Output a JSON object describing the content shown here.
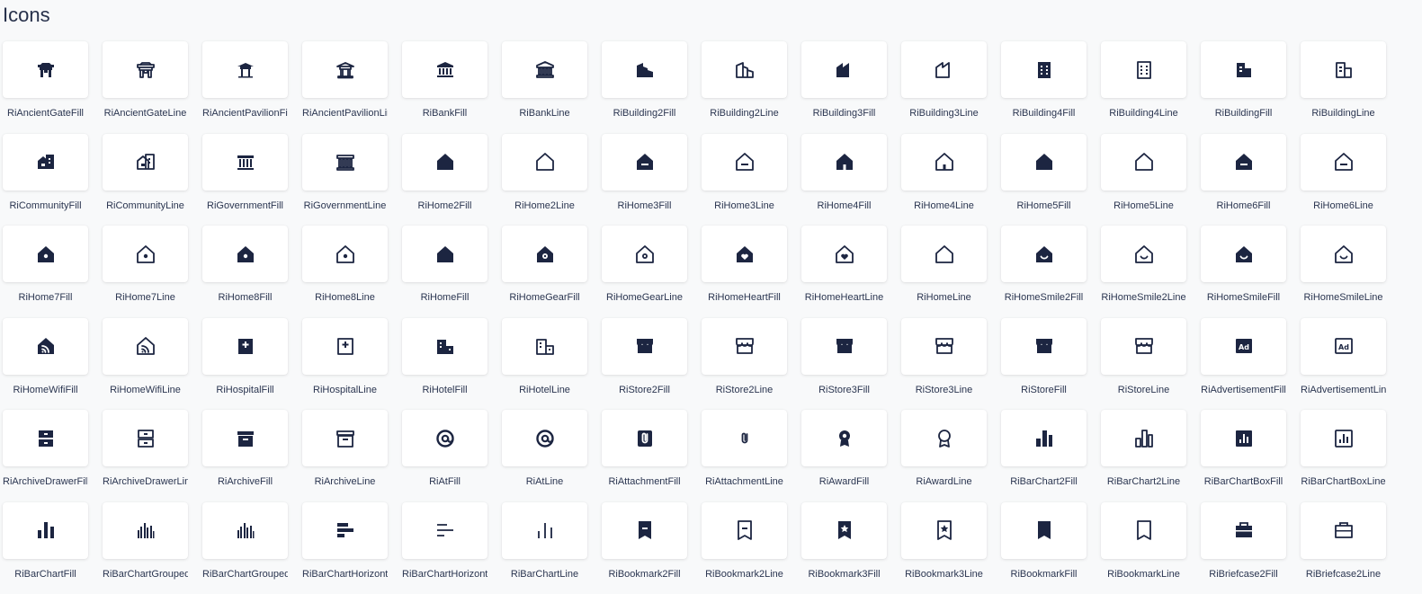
{
  "page": {
    "title": "Icons"
  },
  "icons": [
    {
      "label": "RiAncientGateFill",
      "icon": "ancient-gate-fill"
    },
    {
      "label": "RiAncientGateLine",
      "icon": "ancient-gate-line"
    },
    {
      "label": "RiAncientPavilionFil",
      "icon": "ancient-pavilion-fill"
    },
    {
      "label": "RiAncientPavilionLir",
      "icon": "ancient-pavilion-line"
    },
    {
      "label": "RiBankFill",
      "icon": "bank-fill"
    },
    {
      "label": "RiBankLine",
      "icon": "bank-line"
    },
    {
      "label": "RiBuilding2Fill",
      "icon": "building2-fill"
    },
    {
      "label": "RiBuilding2Line",
      "icon": "building2-line"
    },
    {
      "label": "RiBuilding3Fill",
      "icon": "building3-fill"
    },
    {
      "label": "RiBuilding3Line",
      "icon": "building3-line"
    },
    {
      "label": "RiBuilding4Fill",
      "icon": "building4-fill"
    },
    {
      "label": "RiBuilding4Line",
      "icon": "building4-line"
    },
    {
      "label": "RiBuildingFill",
      "icon": "building-fill"
    },
    {
      "label": "RiBuildingLine",
      "icon": "building-line"
    },
    {
      "label": "RiCommunityFill",
      "icon": "community-fill"
    },
    {
      "label": "RiCommunityLine",
      "icon": "community-line"
    },
    {
      "label": "RiGovernmentFill",
      "icon": "government-fill"
    },
    {
      "label": "RiGovernmentLine",
      "icon": "government-line"
    },
    {
      "label": "RiHome2Fill",
      "icon": "home2-fill"
    },
    {
      "label": "RiHome2Line",
      "icon": "home2-line"
    },
    {
      "label": "RiHome3Fill",
      "icon": "home3-fill"
    },
    {
      "label": "RiHome3Line",
      "icon": "home3-line"
    },
    {
      "label": "RiHome4Fill",
      "icon": "home4-fill"
    },
    {
      "label": "RiHome4Line",
      "icon": "home4-line"
    },
    {
      "label": "RiHome5Fill",
      "icon": "home5-fill"
    },
    {
      "label": "RiHome5Line",
      "icon": "home5-line"
    },
    {
      "label": "RiHome6Fill",
      "icon": "home6-fill"
    },
    {
      "label": "RiHome6Line",
      "icon": "home6-line"
    },
    {
      "label": "RiHome7Fill",
      "icon": "home7-fill"
    },
    {
      "label": "RiHome7Line",
      "icon": "home7-line"
    },
    {
      "label": "RiHome8Fill",
      "icon": "home8-fill"
    },
    {
      "label": "RiHome8Line",
      "icon": "home8-line"
    },
    {
      "label": "RiHomeFill",
      "icon": "home-fill"
    },
    {
      "label": "RiHomeGearFill",
      "icon": "home-gear-fill"
    },
    {
      "label": "RiHomeGearLine",
      "icon": "home-gear-line"
    },
    {
      "label": "RiHomeHeartFill",
      "icon": "home-heart-fill"
    },
    {
      "label": "RiHomeHeartLine",
      "icon": "home-heart-line"
    },
    {
      "label": "RiHomeLine",
      "icon": "home-line"
    },
    {
      "label": "RiHomeSmile2Fill",
      "icon": "home-smile2-fill"
    },
    {
      "label": "RiHomeSmile2Line",
      "icon": "home-smile2-line"
    },
    {
      "label": "RiHomeSmileFill",
      "icon": "home-smile-fill"
    },
    {
      "label": "RiHomeSmileLine",
      "icon": "home-smile-line"
    },
    {
      "label": "RiHomeWifiFill",
      "icon": "home-wifi-fill"
    },
    {
      "label": "RiHomeWifiLine",
      "icon": "home-wifi-line"
    },
    {
      "label": "RiHospitalFill",
      "icon": "hospital-fill"
    },
    {
      "label": "RiHospitalLine",
      "icon": "hospital-line"
    },
    {
      "label": "RiHotelFill",
      "icon": "hotel-fill"
    },
    {
      "label": "RiHotelLine",
      "icon": "hotel-line"
    },
    {
      "label": "RiStore2Fill",
      "icon": "store2-fill"
    },
    {
      "label": "RiStore2Line",
      "icon": "store2-line"
    },
    {
      "label": "RiStore3Fill",
      "icon": "store3-fill"
    },
    {
      "label": "RiStore3Line",
      "icon": "store3-line"
    },
    {
      "label": "RiStoreFill",
      "icon": "store-fill"
    },
    {
      "label": "RiStoreLine",
      "icon": "store-line"
    },
    {
      "label": "RiAdvertisementFill",
      "icon": "advertisement-fill"
    },
    {
      "label": "RiAdvertisementLin",
      "icon": "advertisement-line"
    },
    {
      "label": "RiArchiveDrawerFill",
      "icon": "archive-drawer-fill"
    },
    {
      "label": "RiArchiveDrawerLin",
      "icon": "archive-drawer-line"
    },
    {
      "label": "RiArchiveFill",
      "icon": "archive-fill"
    },
    {
      "label": "RiArchiveLine",
      "icon": "archive-line"
    },
    {
      "label": "RiAtFill",
      "icon": "at-fill"
    },
    {
      "label": "RiAtLine",
      "icon": "at-line"
    },
    {
      "label": "RiAttachmentFill",
      "icon": "attachment-fill"
    },
    {
      "label": "RiAttachmentLine",
      "icon": "attachment-line"
    },
    {
      "label": "RiAwardFill",
      "icon": "award-fill"
    },
    {
      "label": "RiAwardLine",
      "icon": "award-line"
    },
    {
      "label": "RiBarChart2Fill",
      "icon": "bar-chart2-fill"
    },
    {
      "label": "RiBarChart2Line",
      "icon": "bar-chart2-line"
    },
    {
      "label": "RiBarChartBoxFill",
      "icon": "bar-chart-box-fill"
    },
    {
      "label": "RiBarChartBoxLine",
      "icon": "bar-chart-box-line"
    },
    {
      "label": "RiBarChartFill",
      "icon": "bar-chart-fill"
    },
    {
      "label": "RiBarChartGrouped",
      "icon": "bar-chart-grouped-fill"
    },
    {
      "label": "RiBarChartGrouped",
      "icon": "bar-chart-grouped-line"
    },
    {
      "label": "RiBarChartHorizont",
      "icon": "bar-chart-horizontal-fill"
    },
    {
      "label": "RiBarChartHorizont",
      "icon": "bar-chart-horizontal-line"
    },
    {
      "label": "RiBarChartLine",
      "icon": "bar-chart-line"
    },
    {
      "label": "RiBookmark2Fill",
      "icon": "bookmark2-fill"
    },
    {
      "label": "RiBookmark2Line",
      "icon": "bookmark2-line"
    },
    {
      "label": "RiBookmark3Fill",
      "icon": "bookmark3-fill"
    },
    {
      "label": "RiBookmark3Line",
      "icon": "bookmark3-line"
    },
    {
      "label": "RiBookmarkFill",
      "icon": "bookmark-fill"
    },
    {
      "label": "RiBookmarkLine",
      "icon": "bookmark-line"
    },
    {
      "label": "RiBriefcase2Fill",
      "icon": "briefcase2-fill"
    },
    {
      "label": "RiBriefcase2Line",
      "icon": "briefcase2-line"
    }
  ]
}
